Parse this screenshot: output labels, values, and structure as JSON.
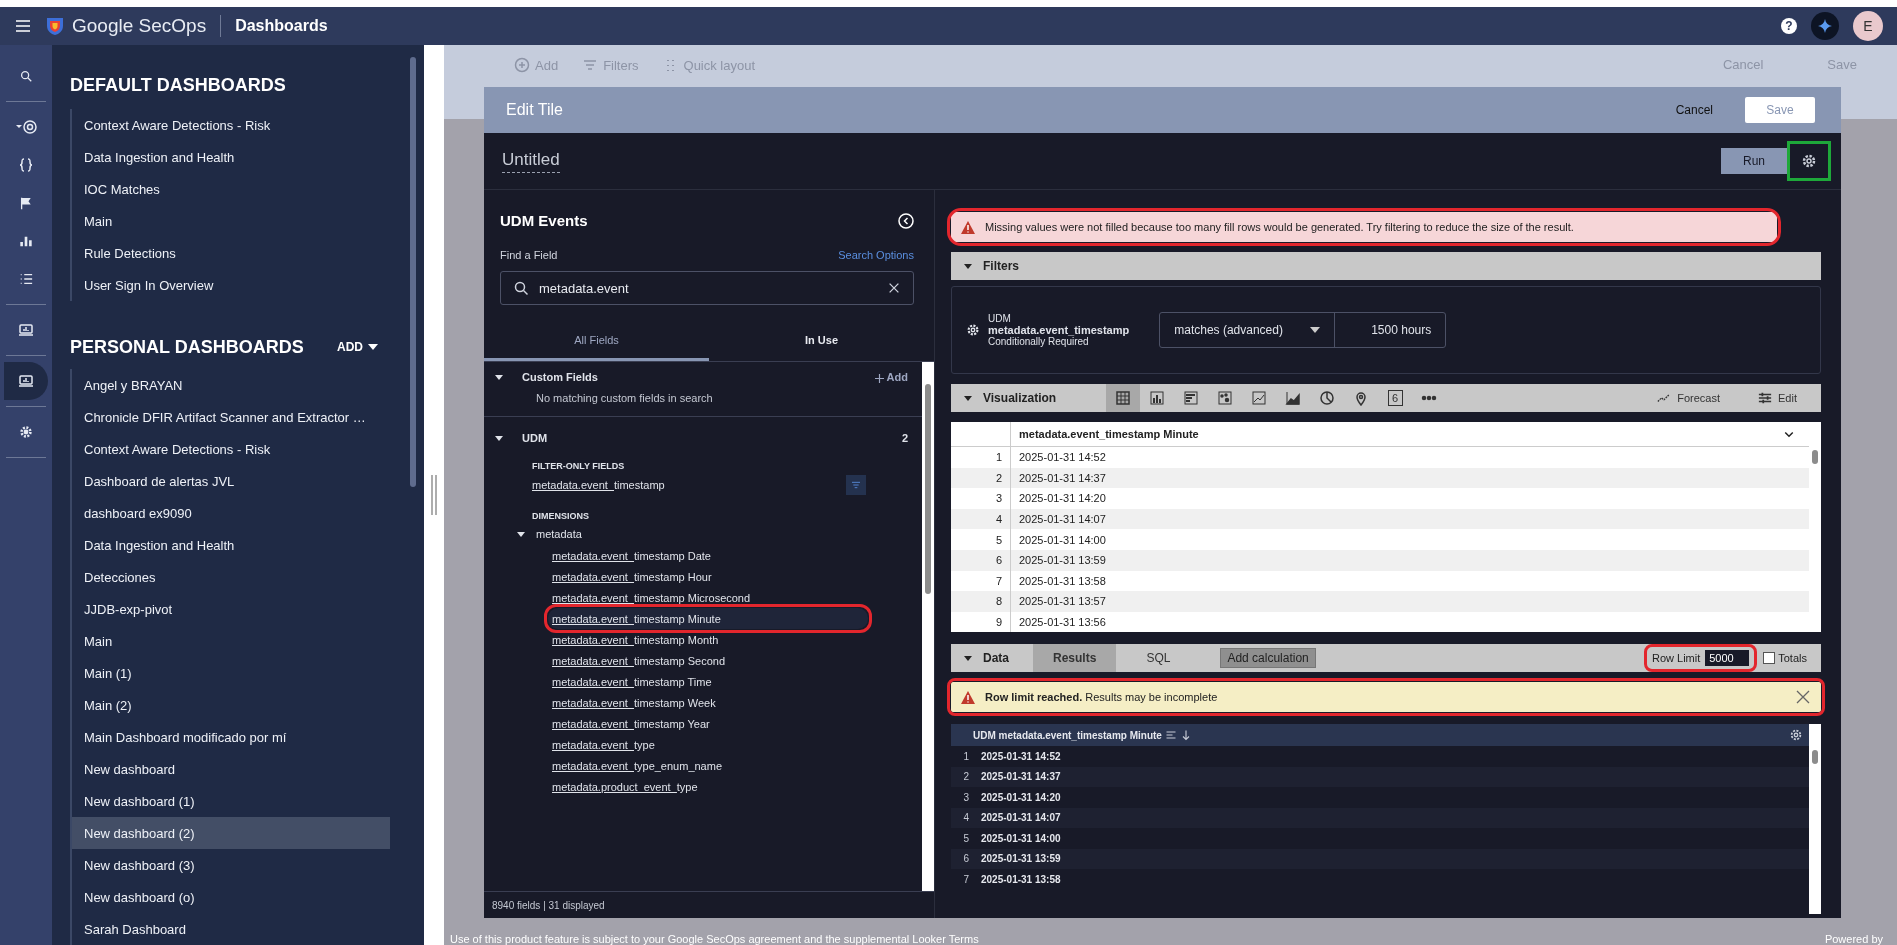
{
  "topbar": {
    "product": "Google SecOps",
    "section": "Dashboards",
    "help": "?",
    "avatar": "E"
  },
  "rail": [
    {
      "kind": "search",
      "selected": false
    },
    {
      "kind": "radar",
      "selected": false
    },
    {
      "kind": "braces",
      "selected": false
    },
    {
      "kind": "flag",
      "selected": false
    },
    {
      "kind": "chart",
      "selected": false
    },
    {
      "kind": "list",
      "selected": false
    },
    {
      "kind": "dashboard",
      "selected": false
    },
    {
      "kind": "dashboard",
      "selected": true
    },
    {
      "kind": "settings",
      "selected": false
    }
  ],
  "sidebar": {
    "default_heading": "DEFAULT DASHBOARDS",
    "personal_heading": "PERSONAL DASHBOARDS",
    "add": "ADD",
    "default_items": [
      {
        "label": "Context Aware Detections - Risk",
        "selected": false
      },
      {
        "label": "Data Ingestion and Health",
        "selected": false
      },
      {
        "label": "IOC Matches",
        "selected": false
      },
      {
        "label": "Main",
        "selected": false
      },
      {
        "label": "Rule Detections",
        "selected": false
      },
      {
        "label": "User Sign In Overview",
        "selected": false
      }
    ],
    "personal_items": [
      {
        "label": "Angel y BRAYAN",
        "selected": false
      },
      {
        "label": "Chronicle DFIR Artifact Scanner and Extractor …",
        "selected": false
      },
      {
        "label": "Context Aware Detections - Risk",
        "selected": false
      },
      {
        "label": "Dashboard de alertas JVL",
        "selected": false
      },
      {
        "label": "dashboard ex9090",
        "selected": false
      },
      {
        "label": "Data Ingestion and Health",
        "selected": false
      },
      {
        "label": "Detecciones",
        "selected": false
      },
      {
        "label": "JJDB-exp-pivot",
        "selected": false
      },
      {
        "label": "Main",
        "selected": false
      },
      {
        "label": "Main (1)",
        "selected": false
      },
      {
        "label": "Main (2)",
        "selected": false
      },
      {
        "label": "Main Dashboard modificado por mí",
        "selected": false
      },
      {
        "label": "New dashboard",
        "selected": false
      },
      {
        "label": "New dashboard (1)",
        "selected": false
      },
      {
        "label": "New dashboard (2)",
        "selected": true
      },
      {
        "label": "New dashboard (3)",
        "selected": false
      },
      {
        "label": "New dashboard (o)",
        "selected": false
      },
      {
        "label": "Sarah Dashboard",
        "selected": false
      }
    ]
  },
  "background_toolbar": {
    "add": "Add",
    "filters": "Filters",
    "quick_layout": "Quick layout",
    "cancel": "Cancel",
    "save": "Save"
  },
  "footer": {
    "notice": "Use of this product feature is subject to your Google SecOps agreement and the supplemental Looker Terms",
    "powered_by": "Powered by"
  },
  "edit_tile": {
    "title": "Edit Tile",
    "cancel": "Cancel",
    "save": "Save",
    "tile_name": "Untitled",
    "run": "Run",
    "settings_annotation": {
      "color": "#1ea83a"
    },
    "field_picker": {
      "title": "UDM Events",
      "find_label": "Find a Field",
      "search_options": "Search Options",
      "search_value": "metadata.event",
      "tabs": [
        {
          "label": "All Fields",
          "selected": true
        },
        {
          "label": "In Use",
          "selected": false
        }
      ],
      "custom_fields": {
        "label": "Custom Fields",
        "expanded": true,
        "add": "Add",
        "empty": "No matching custom fields in search"
      },
      "udm": {
        "label": "UDM",
        "expanded": true,
        "count": "2",
        "filter_only_heading": "FILTER-ONLY FIELDS",
        "filter_only": [
          {
            "match": "metadata.event_",
            "rest": "timestamp"
          }
        ],
        "dimensions_heading": "DIMENSIONS",
        "group": {
          "label": "metadata",
          "expanded": true
        },
        "fields": [
          {
            "match": "metadata.event_",
            "rest": "timestamp Date",
            "selected": false
          },
          {
            "match": "metadata.event_",
            "rest": "timestamp Hour",
            "selected": false
          },
          {
            "match": "metadata.event_",
            "rest": "timestamp Microsecond",
            "selected": false
          },
          {
            "match": "metadata.event_",
            "rest": "timestamp Minute",
            "selected": true,
            "annotation": {
              "color": "#e3262d"
            }
          },
          {
            "match": "metadata.event_",
            "rest": "timestamp Month",
            "selected": false
          },
          {
            "match": "metadata.event_",
            "rest": "timestamp Second",
            "selected": false
          },
          {
            "match": "metadata.event_",
            "rest": "timestamp Time",
            "selected": false
          },
          {
            "match": "metadata.event_",
            "rest": "timestamp Week",
            "selected": false
          },
          {
            "match": "metadata.event_",
            "rest": "timestamp Year",
            "selected": false
          },
          {
            "match": "metadata.event_",
            "rest": "type",
            "selected": false
          },
          {
            "match": "metadata.event_",
            "rest": "type_enum_name",
            "selected": false
          },
          {
            "match": "metadata.product_event_",
            "rest": "type",
            "selected": false
          }
        ]
      },
      "footer": "8940 fields | 31 displayed"
    },
    "fill_warning": {
      "text": "Missing values were not filled because too many fill rows would be generated. Try filtering to reduce the size of the result.",
      "annotation": {
        "color": "#e3262d"
      }
    },
    "filters": {
      "label": "Filters",
      "expanded": true,
      "group": "UDM",
      "field": "metadata.event_timestamp",
      "note": "Conditionally Required",
      "operator": "matches (advanced)",
      "value": "1500 hours"
    },
    "visualization": {
      "label": "Visualization",
      "expanded": true,
      "forecast": "Forecast",
      "edit": "Edit",
      "types": [
        {
          "kind": "table",
          "selected": true
        },
        {
          "kind": "column",
          "selected": false
        },
        {
          "kind": "bar",
          "selected": false
        },
        {
          "kind": "scatter",
          "selected": false
        },
        {
          "kind": "line",
          "selected": false
        },
        {
          "kind": "area",
          "selected": false
        },
        {
          "kind": "pie",
          "selected": false
        },
        {
          "kind": "map",
          "selected": false
        },
        {
          "kind": "single",
          "glyph": "6",
          "selected": false
        },
        {
          "kind": "more",
          "selected": false
        }
      ],
      "column": "metadata.event_timestamp Minute",
      "rows": [
        {
          "n": "1",
          "value": "2025-01-31 14:52"
        },
        {
          "n": "2",
          "value": "2025-01-31 14:37"
        },
        {
          "n": "3",
          "value": "2025-01-31 14:20"
        },
        {
          "n": "4",
          "value": "2025-01-31 14:07"
        },
        {
          "n": "5",
          "value": "2025-01-31 14:00"
        },
        {
          "n": "6",
          "value": "2025-01-31 13:59"
        },
        {
          "n": "7",
          "value": "2025-01-31 13:58"
        },
        {
          "n": "8",
          "value": "2025-01-31 13:57"
        },
        {
          "n": "9",
          "value": "2025-01-31 13:56"
        }
      ]
    },
    "data": {
      "label": "Data",
      "expanded": true,
      "tabs": [
        {
          "label": "Results",
          "selected": true
        },
        {
          "label": "SQL",
          "selected": false
        }
      ],
      "add_calculation": "Add calculation",
      "row_limit_label": "Row Limit",
      "row_limit": "5000",
      "row_limit_annotation": {
        "color": "#e3262d"
      },
      "totals": "Totals",
      "totals_checked": false
    },
    "row_warning": {
      "text": "**Row limit reached.** Results may be incomplete",
      "annotation": {
        "color": "#e3262d"
      }
    },
    "results": {
      "column": "UDM metadata.event_timestamp Minute",
      "rows": [
        {
          "n": "1",
          "value": "2025-01-31 14:52"
        },
        {
          "n": "2",
          "value": "2025-01-31 14:37"
        },
        {
          "n": "3",
          "value": "2025-01-31 14:20"
        },
        {
          "n": "4",
          "value": "2025-01-31 14:07"
        },
        {
          "n": "5",
          "value": "2025-01-31 14:00"
        },
        {
          "n": "6",
          "value": "2025-01-31 13:59"
        },
        {
          "n": "7",
          "value": "2025-01-31 13:58"
        }
      ]
    }
  }
}
